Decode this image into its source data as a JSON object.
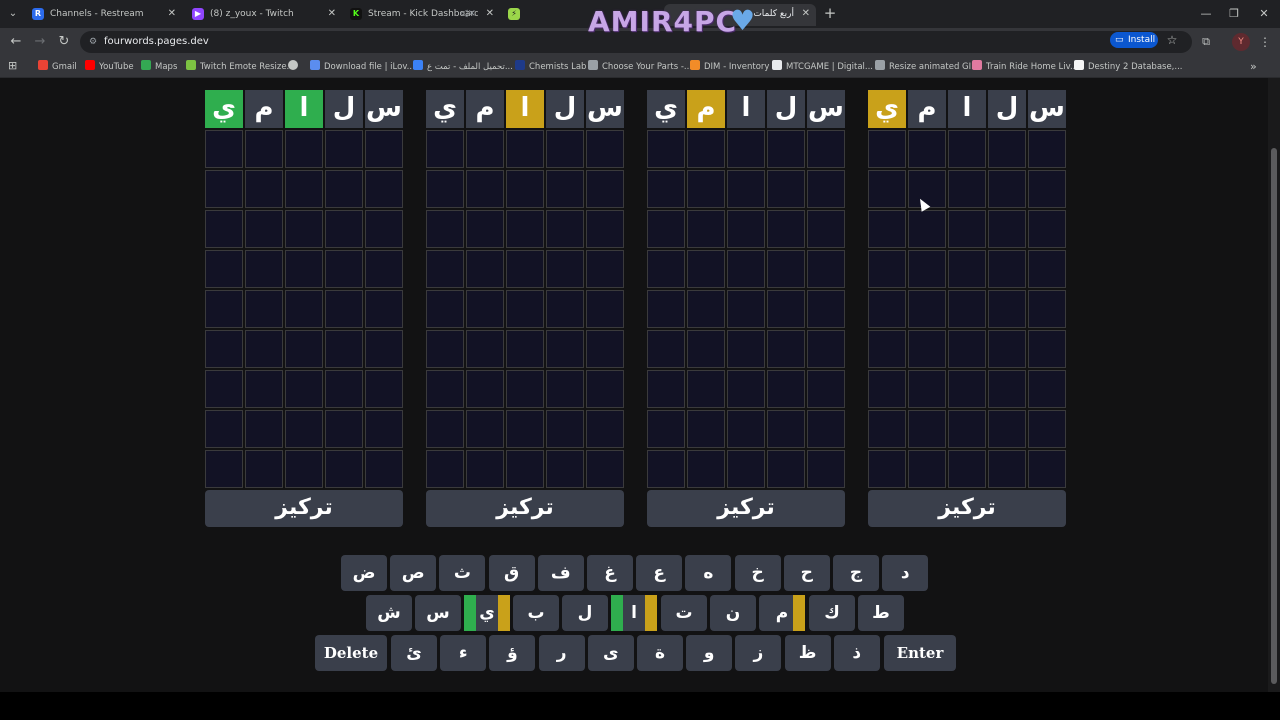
{
  "browser": {
    "tabs": [
      {
        "title": "Channels - Restream",
        "fav": "R",
        "favColor": "#2c6bed"
      },
      {
        "title": "(8) z_youx - Twitch",
        "fav": "▶",
        "favColor": "#9146ff"
      },
      {
        "title": "Stream - Kick Dashboard",
        "fav": "K",
        "favColor": "#53fc18"
      },
      {
        "title": "",
        "fav": "",
        "favColor": "#9bd64a"
      },
      {
        "title": "أربع كلمات",
        "fav": "",
        "favColor": "#1f6b3a"
      }
    ],
    "url": "fourwords.pages.dev",
    "install_label": "Install",
    "profile_initial": "Y",
    "bookmarks": [
      "Gmail",
      "YouTube",
      "Maps",
      "Twitch Emote Resize...",
      "",
      "Download file | iLov...",
      "تحميل الملف - تمت ع...",
      "Chemists Lab",
      "Choose Your Parts -...",
      "DIM - Inventory",
      "MTCGAME | Digital...",
      "Resize animated GIF",
      "Train Ride Home Liv...",
      "Destiny 2 Database,..."
    ]
  },
  "watermark": "AMIR4PC",
  "game": {
    "boards": [
      {
        "guess": [
          {
            "letter": "س",
            "state": "grey"
          },
          {
            "letter": "ل",
            "state": "grey"
          },
          {
            "letter": "ا",
            "state": "green"
          },
          {
            "letter": "م",
            "state": "grey"
          },
          {
            "letter": "ي",
            "state": "green"
          }
        ],
        "focus_label": "تركيز"
      },
      {
        "guess": [
          {
            "letter": "س",
            "state": "grey"
          },
          {
            "letter": "ل",
            "state": "grey"
          },
          {
            "letter": "ا",
            "state": "yellow"
          },
          {
            "letter": "م",
            "state": "grey"
          },
          {
            "letter": "ي",
            "state": "grey"
          }
        ],
        "focus_label": "تركيز"
      },
      {
        "guess": [
          {
            "letter": "س",
            "state": "grey"
          },
          {
            "letter": "ل",
            "state": "grey"
          },
          {
            "letter": "ا",
            "state": "grey"
          },
          {
            "letter": "م",
            "state": "yellow"
          },
          {
            "letter": "ي",
            "state": "grey"
          }
        ],
        "focus_label": "تركيز"
      },
      {
        "guess": [
          {
            "letter": "س",
            "state": "grey"
          },
          {
            "letter": "ل",
            "state": "grey"
          },
          {
            "letter": "ا",
            "state": "grey"
          },
          {
            "letter": "م",
            "state": "grey"
          },
          {
            "letter": "ي",
            "state": "yellow"
          }
        ],
        "focus_label": "تركيز"
      }
    ],
    "empty_rows": 9,
    "keyboard": {
      "row1": [
        "ض",
        "ص",
        "ث",
        "ق",
        "ف",
        "غ",
        "ع",
        "ه",
        "خ",
        "ح",
        "ج",
        "د"
      ],
      "row2": [
        "ش",
        "س",
        "ي",
        "ب",
        "ل",
        "ا",
        "ت",
        "ن",
        "م",
        "ك",
        "ط"
      ],
      "row3": [
        "Delete",
        "ئ",
        "ء",
        "ؤ",
        "ر",
        "ى",
        "ة",
        "و",
        "ز",
        "ظ",
        "ذ",
        "Enter"
      ],
      "row2_marks": {
        "ي": [
          "green",
          "yellow"
        ],
        "ا": [
          "green",
          "yellow"
        ],
        "م": [
          "yellow"
        ]
      }
    }
  }
}
